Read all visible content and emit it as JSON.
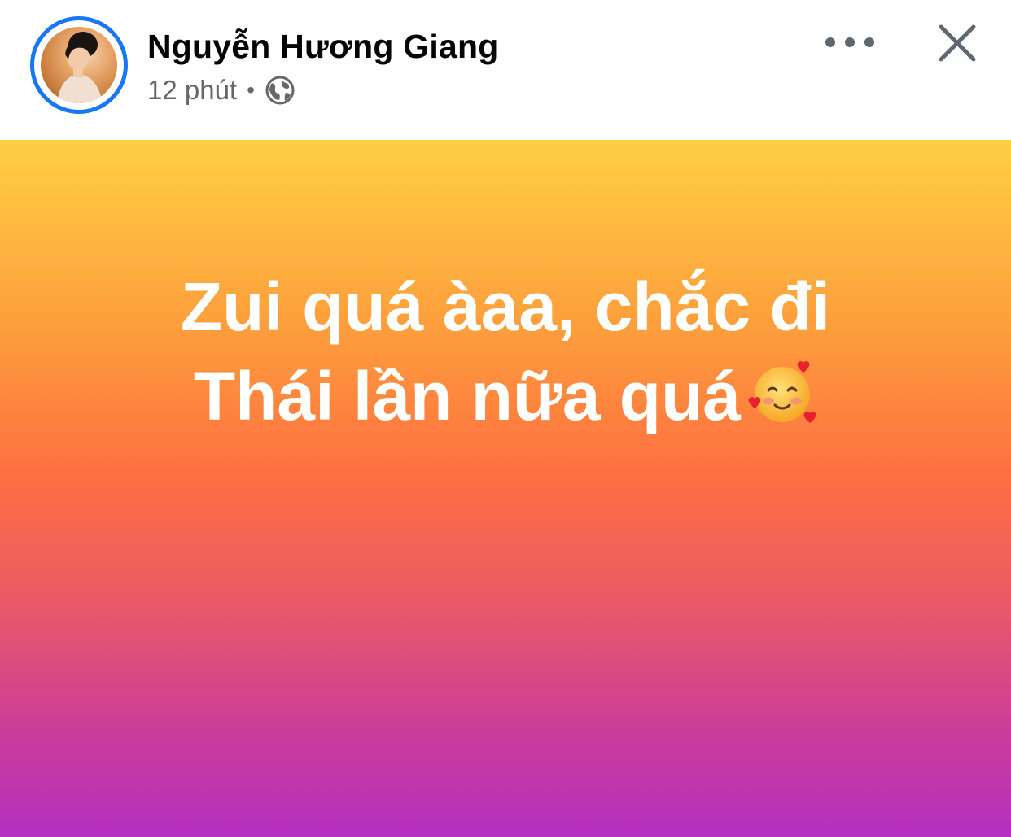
{
  "post": {
    "author_name": "Nguyễn Hương Giang",
    "timestamp": "12 phút",
    "separator": "•",
    "privacy_icon": "globe-icon",
    "more_icon": "more-horizontal-icon",
    "close_icon": "close-icon",
    "text_line_1": "Zui quá àaa, chắc đi",
    "text_line_2": "Thái lần nữa quá",
    "emoji": "smiling-face-with-hearts-icon",
    "colors": {
      "ring": "#1877f2",
      "gradient_top": "#fecf43",
      "gradient_mid": "#fe6f41",
      "gradient_bottom": "#b52fc0",
      "text": "#ffffff"
    }
  }
}
